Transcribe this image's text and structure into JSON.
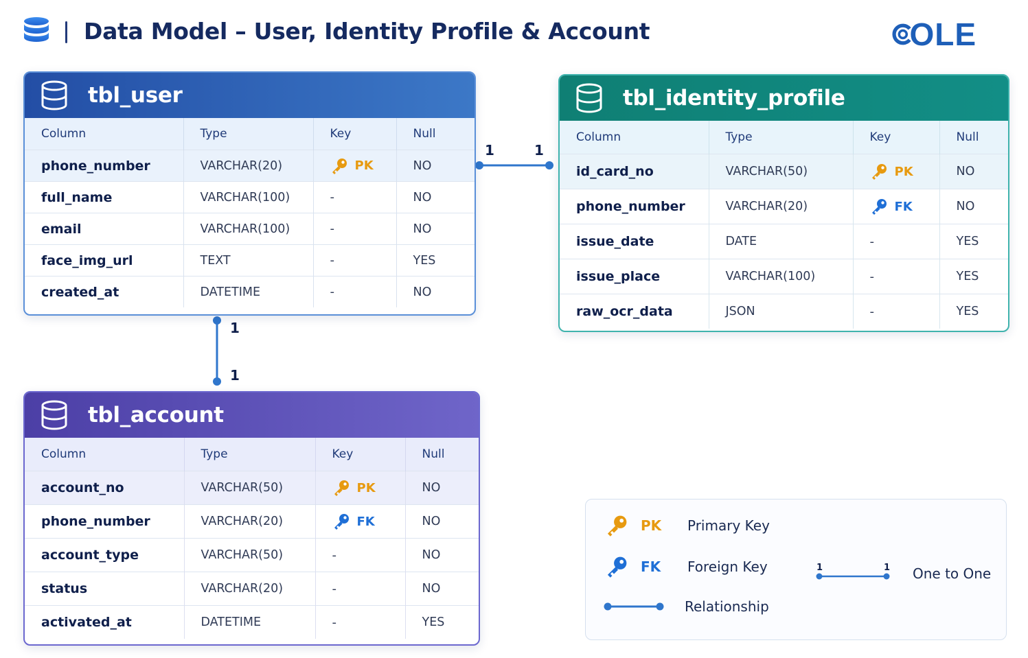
{
  "header": {
    "title": "Data Model – User, Identity Profile & Account",
    "logo_text": "OLE",
    "logo_color": "#1e5fb8"
  },
  "columns": [
    "Column",
    "Type",
    "Key",
    "Null"
  ],
  "tables": {
    "user": {
      "name": "tbl_user",
      "color": "#2a5aae",
      "rows": [
        {
          "column": "phone_number",
          "type": "VARCHAR(20)",
          "key": "PK",
          "null": "NO"
        },
        {
          "column": "full_name",
          "type": "VARCHAR(100)",
          "key": "-",
          "null": "NO"
        },
        {
          "column": "email",
          "type": "VARCHAR(100)",
          "key": "-",
          "null": "NO"
        },
        {
          "column": "face_img_url",
          "type": "TEXT",
          "key": "-",
          "null": "YES"
        },
        {
          "column": "created_at",
          "type": "DATETIME",
          "key": "-",
          "null": "NO"
        }
      ]
    },
    "identity_profile": {
      "name": "tbl_identity_profile",
      "color": "#0f7f74",
      "rows": [
        {
          "column": "id_card_no",
          "type": "VARCHAR(50)",
          "key": "PK",
          "null": "NO"
        },
        {
          "column": "phone_number",
          "type": "VARCHAR(20)",
          "key": "FK",
          "null": "NO"
        },
        {
          "column": "issue_date",
          "type": "DATE",
          "key": "-",
          "null": "YES"
        },
        {
          "column": "issue_place",
          "type": "VARCHAR(100)",
          "key": "-",
          "null": "YES"
        },
        {
          "column": "raw_ocr_data",
          "type": "JSON",
          "key": "-",
          "null": "YES"
        }
      ]
    },
    "account": {
      "name": "tbl_account",
      "color": "#5346b0",
      "rows": [
        {
          "column": "account_no",
          "type": "VARCHAR(50)",
          "key": "PK",
          "null": "NO"
        },
        {
          "column": "phone_number",
          "type": "VARCHAR(20)",
          "key": "FK",
          "null": "NO"
        },
        {
          "column": "account_type",
          "type": "VARCHAR(50)",
          "key": "-",
          "null": "NO"
        },
        {
          "column": "status",
          "type": "VARCHAR(20)",
          "key": "-",
          "null": "NO"
        },
        {
          "column": "activated_at",
          "type": "DATETIME",
          "key": "-",
          "null": "YES"
        }
      ]
    }
  },
  "relationships": {
    "user_identity": {
      "left": "1",
      "right": "1"
    },
    "user_account": {
      "top": "1",
      "bottom": "1"
    }
  },
  "legend": {
    "pk_label": "PK",
    "pk_desc": "Primary Key",
    "fk_label": "FK",
    "fk_desc": "Foreign Key",
    "relationship_desc": "Relationship",
    "one_left": "1",
    "one_right": "1",
    "one_to_one": "One to One"
  },
  "colors": {
    "pk": "#e79a10",
    "fk": "#1f6fd6",
    "line": "#2f76cc"
  },
  "icons": {
    "header": "database-icon",
    "table": "database-icon",
    "pk": "key-icon",
    "fk": "key-icon"
  }
}
